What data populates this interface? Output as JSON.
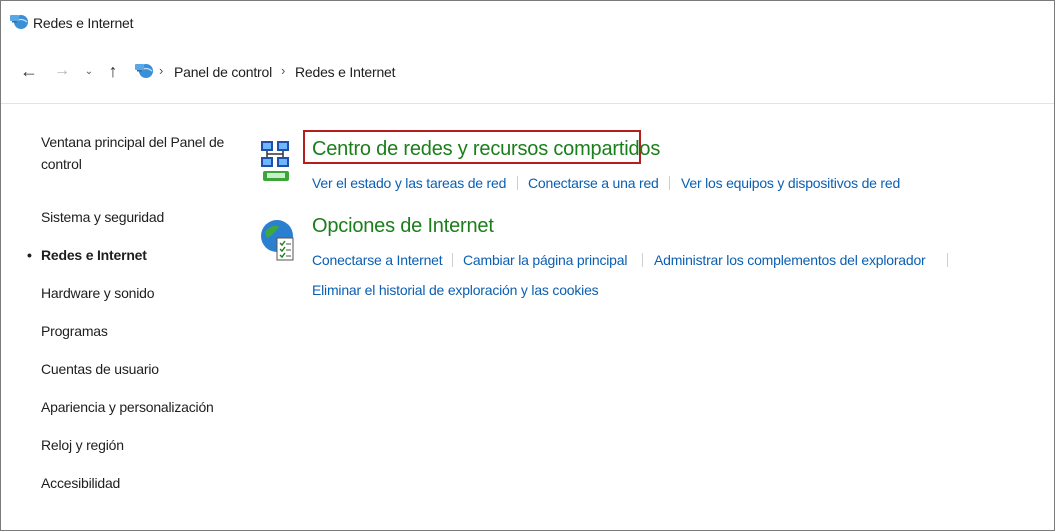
{
  "window": {
    "title": "Redes e Internet",
    "icon": "network-globe-icon"
  },
  "nav": {
    "back": "←",
    "forward": "→",
    "recent": "⌄",
    "up": "↑",
    "breadcrumb": [
      "Panel de control",
      "Redes e Internet"
    ],
    "separator": "›"
  },
  "sidebar": {
    "items": [
      "Ventana principal del Panel de control",
      "Sistema y seguridad",
      "Redes e Internet",
      "Hardware y sonido",
      "Programas",
      "Cuentas de usuario",
      "Apariencia y personalización",
      "Reloj y región",
      "Accesibilidad"
    ],
    "active": "Redes e Internet",
    "bullet": "•"
  },
  "sections": [
    {
      "icon": "network-center-icon",
      "title": "Centro de redes y recursos compartidos",
      "links": [
        "Ver el estado y las tareas de red",
        "Conectarse a una red",
        "Ver los equipos y dispositivos de red"
      ]
    },
    {
      "icon": "internet-options-icon",
      "title": "Opciones de Internet",
      "links": [
        "Conectarse a Internet",
        "Cambiar la página principal",
        "Administrar los complementos del explorador",
        "Eliminar el historial de exploración y las cookies"
      ]
    }
  ],
  "colors": {
    "title_green": "#1a7f1a",
    "link_blue": "#0b5fb3",
    "highlight_red": "#b41e1e"
  }
}
